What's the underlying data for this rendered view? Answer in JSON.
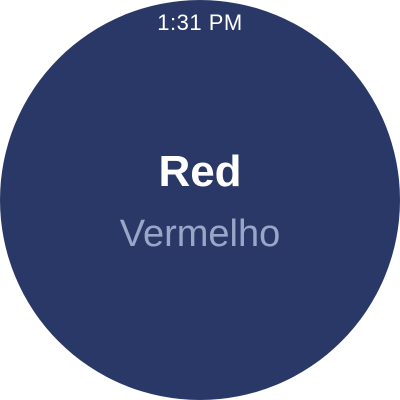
{
  "status_bar": {
    "time": "1:31 PM"
  },
  "card": {
    "word": "Red",
    "translation": "Vermelho"
  },
  "colors": {
    "background": "#2a3868",
    "primary_text": "#ffffff",
    "secondary_text": "#9aa6c8"
  }
}
